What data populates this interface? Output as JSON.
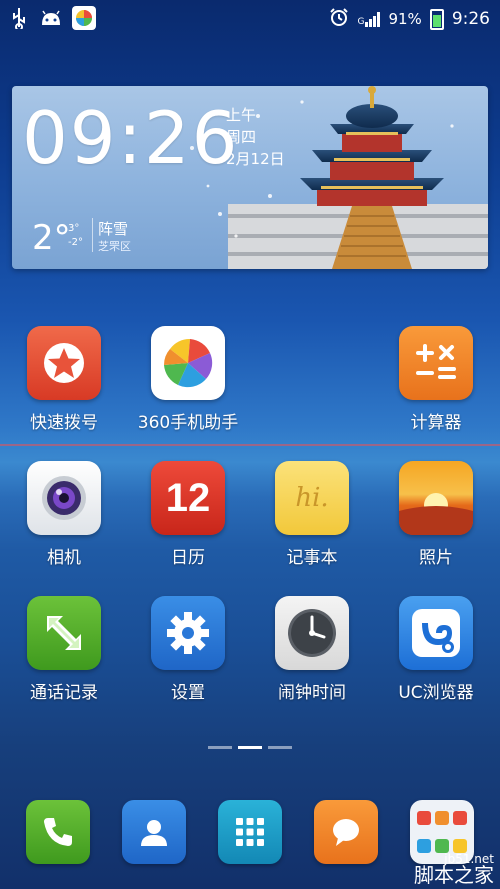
{
  "status": {
    "battery": "91%",
    "time": "9:26",
    "network": "G"
  },
  "widget": {
    "time": "09:26",
    "ampm": "上午",
    "weekday": "周四",
    "date": "2月12日",
    "temp": "2°",
    "temp_high": "3°",
    "temp_low": "-2°",
    "weather": "阵雪",
    "area": "芝罘区"
  },
  "apps_row1": [
    {
      "label": "快速拨号"
    },
    {
      "label": "360手机助手"
    },
    {
      "label": "计算器"
    }
  ],
  "apps_row2": [
    {
      "label": "相机"
    },
    {
      "label": "日历"
    },
    {
      "label": "记事本"
    },
    {
      "label": "照片"
    }
  ],
  "apps_row3": [
    {
      "label": "通话记录"
    },
    {
      "label": "设置"
    },
    {
      "label": "闹钟时间"
    },
    {
      "label": "UC浏览器"
    }
  ],
  "calendar_day": "12",
  "notepad_text": "hi.",
  "watermark": {
    "line1": "jb51.net",
    "line2": "脚本之家"
  }
}
